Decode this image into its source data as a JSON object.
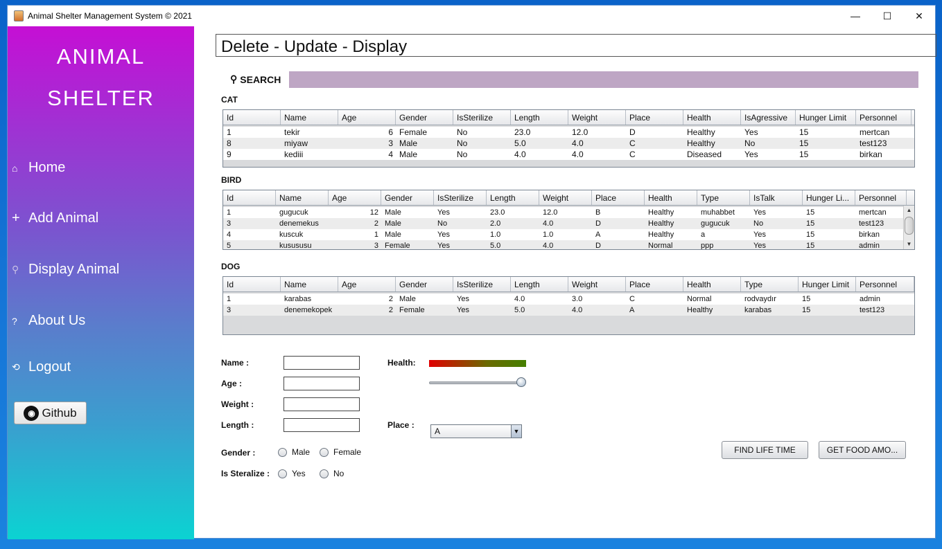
{
  "window": {
    "title": "Animal Shelter Management System © 2021",
    "controls": [
      "—",
      "☐",
      "✕"
    ]
  },
  "sidebar": {
    "brand_line1": "ANIMAL",
    "brand_line2": "SHELTER",
    "items": [
      {
        "label": "Home",
        "icon": "home-icon",
        "glyph": "⌂"
      },
      {
        "label": "Add Animal",
        "icon": "plus-icon",
        "glyph": "+"
      },
      {
        "label": "Display Animal",
        "icon": "wrench-icon",
        "glyph": "⚲"
      },
      {
        "label": "About Us",
        "icon": "question-icon",
        "glyph": "?"
      },
      {
        "label": "Logout",
        "icon": "logout-icon",
        "glyph": "⟲"
      }
    ],
    "github_label": "Github"
  },
  "main": {
    "header": "Delete - Update - Display",
    "search_label": "SEARCH",
    "search_value": ""
  },
  "cat": {
    "label": "CAT",
    "columns": [
      "Id",
      "Name",
      "Age",
      "Gender",
      "IsSterilize",
      "Length",
      "Weight",
      "Place",
      "Health",
      "IsAgressive",
      "Hunger Limit",
      "Personnel"
    ],
    "rows": [
      [
        "1",
        "tekir",
        "6",
        "Female",
        "No",
        "23.0",
        "12.0",
        "D",
        "Healthy",
        "Yes",
        "15",
        "mertcan"
      ],
      [
        "8",
        "miyaw",
        "3",
        "Male",
        "No",
        "5.0",
        "4.0",
        "C",
        "Healthy",
        "No",
        "15",
        "test123"
      ],
      [
        "9",
        "kediii",
        "4",
        "Male",
        "No",
        "4.0",
        "4.0",
        "C",
        "Diseased",
        "Yes",
        "15",
        "birkan"
      ]
    ]
  },
  "bird": {
    "label": "BIRD",
    "columns": [
      "Id",
      "Name",
      "Age",
      "Gender",
      "IsSterilize",
      "Length",
      "Weight",
      "Place",
      "Health",
      "Type",
      "IsTalk",
      "Hunger Li...",
      "Personnel"
    ],
    "rows": [
      [
        "1",
        "gugucuk",
        "12",
        "Male",
        "Yes",
        "23.0",
        "12.0",
        "B",
        "Healthy",
        "muhabbet",
        "Yes",
        "15",
        "mertcan"
      ],
      [
        "3",
        "denemekus",
        "2",
        "Male",
        "No",
        "2.0",
        "4.0",
        "D",
        "Healthy",
        "gugucuk",
        "No",
        "15",
        "test123"
      ],
      [
        "4",
        "kuscuk",
        "1",
        "Male",
        "Yes",
        "1.0",
        "1.0",
        "A",
        "Healthy",
        "a",
        "Yes",
        "15",
        "birkan"
      ],
      [
        "5",
        "kusususu",
        "3",
        "Female",
        "Yes",
        "5.0",
        "4.0",
        "D",
        "Normal",
        "ppp",
        "Yes",
        "15",
        "admin"
      ]
    ]
  },
  "dog": {
    "label": "DOG",
    "columns": [
      "Id",
      "Name",
      "Age",
      "Gender",
      "IsSterilize",
      "Length",
      "Weight",
      "Place",
      "Health",
      "Type",
      "Hunger Limit",
      "Personnel"
    ],
    "rows": [
      [
        "1",
        "karabas",
        "2",
        "Male",
        "Yes",
        "4.0",
        "3.0",
        "C",
        "Normal",
        "rodvaydır",
        "15",
        "admin"
      ],
      [
        "3",
        "denemekopek",
        "2",
        "Female",
        "Yes",
        "5.0",
        "4.0",
        "A",
        "Healthy",
        "karabas",
        "15",
        "test123"
      ]
    ]
  },
  "form": {
    "name_label": "Name :",
    "age_label": "Age :",
    "weight_label": "Weight :",
    "length_label": "Length :",
    "health_label": "Health:",
    "place_label": "Place :",
    "place_value": "A",
    "gender_label": "Gender :",
    "gender_male": "Male",
    "gender_female": "Female",
    "sterilize_label": "Is Steralize :",
    "sterilize_yes": "Yes",
    "sterilize_no": "No",
    "health_slider_value": 1.0,
    "find_life_time_button": "FIND LIFE TIME",
    "get_food_button": "GET FOOD AMO..."
  }
}
